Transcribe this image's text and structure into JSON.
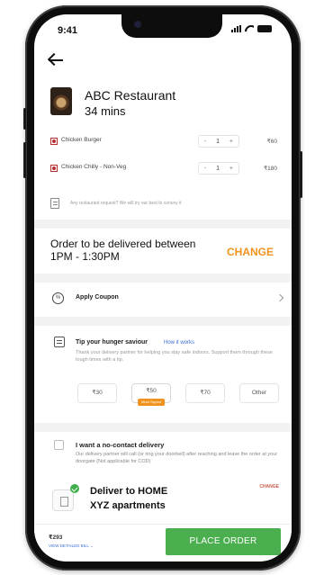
{
  "status_bar": {
    "time": "9:41"
  },
  "restaurant": {
    "name": "ABC Restaurant",
    "eta": "34 mins"
  },
  "cart_items": [
    {
      "name": "Chicken Burger",
      "qty": "1",
      "price": "₹60",
      "minus": "-",
      "plus": "+"
    },
    {
      "name": "Chicken Chilly - Non-Veg",
      "qty": "1",
      "price": "₹180",
      "minus": "-",
      "plus": "+"
    }
  ],
  "note": {
    "text": "Any restaurant request? We will try our best to convey it"
  },
  "delivery_time": {
    "text": "Order to be delivered between 1PM - 1:30PM",
    "change_label": "CHANGE"
  },
  "coupon": {
    "label": "Apply Coupon",
    "icon_text": "%"
  },
  "tip": {
    "title": "Tip your hunger saviour",
    "link": "How it works",
    "description": "Thank your delivery partner for helping you stay safe indoors. Support them through these tough times with a tip.",
    "options": [
      {
        "label": "₹30"
      },
      {
        "label": "₹50",
        "badge": "Most Tipped"
      },
      {
        "label": "₹70"
      },
      {
        "label": "Other"
      }
    ]
  },
  "no_contact": {
    "title": "I want a no-contact delivery",
    "description": "Our delivery partner will call (or ring your doorbell) after reaching and leave the order at your doorgate (Not applicable for COD)",
    "change_label": "CHANGE"
  },
  "address": {
    "title": "Deliver to HOME",
    "detail": "XYZ apartments"
  },
  "footer": {
    "total": "₹293",
    "view_bill": "VIEW DETAILED BILL",
    "place_order": "PLACE ORDER"
  },
  "colors": {
    "accent": "#f0931e",
    "primary_button": "#4bae4f",
    "link": "#3a6fd8"
  }
}
